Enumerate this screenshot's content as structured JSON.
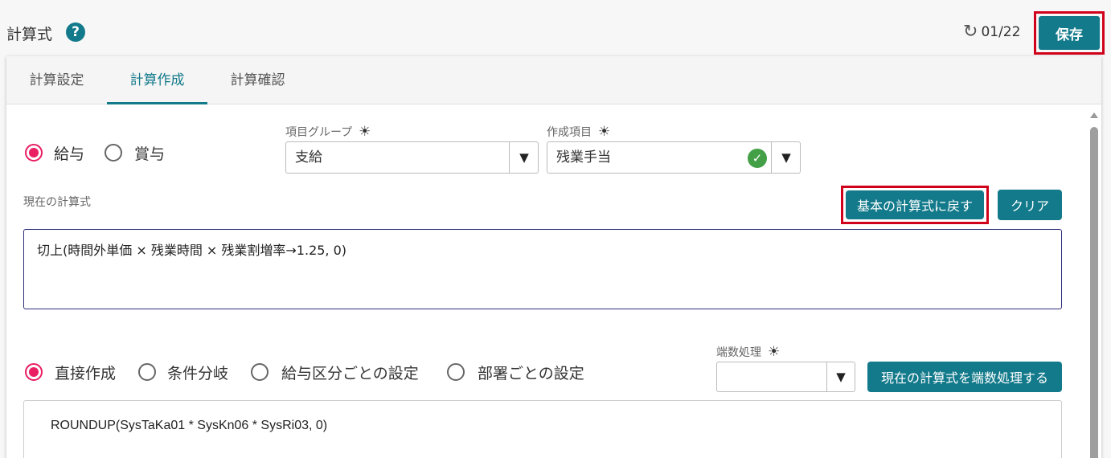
{
  "header": {
    "title": "計算式",
    "help_icon": "?",
    "history_icon": "history-icon",
    "history_count": "01/22",
    "save_label": "保存"
  },
  "tabs": [
    {
      "label": "計算設定",
      "active": false
    },
    {
      "label": "計算作成",
      "active": true
    },
    {
      "label": "計算確認",
      "active": false
    }
  ],
  "pay_type": {
    "options": [
      "給与",
      "賞与"
    ],
    "selected": "給与"
  },
  "item_group": {
    "label": "項目グループ",
    "value": "支給"
  },
  "create_item": {
    "label": "作成項目",
    "value": "残業手当"
  },
  "current_formula": {
    "label": "現在の計算式",
    "reset_label": "基本の計算式に戻す",
    "clear_label": "クリア",
    "text": "切上(時間外単価 × 残業時間 × 残業割増率→1.25, 0)"
  },
  "create_mode": {
    "options": [
      "直接作成",
      "条件分岐",
      "給与区分ごとの設定",
      "部署ごとの設定"
    ],
    "selected": "直接作成"
  },
  "rounding": {
    "label": "端数処理",
    "value": "",
    "apply_label": "現在の計算式を端数処理する"
  },
  "code": {
    "text": "ROUNDUP(SysTaKa01 * SysKn06 * SysRi03, 0)"
  },
  "colors": {
    "accent": "#137a8b",
    "radio_selected": "#e91e63",
    "highlight": "#d0021b",
    "valid": "#43a047"
  }
}
